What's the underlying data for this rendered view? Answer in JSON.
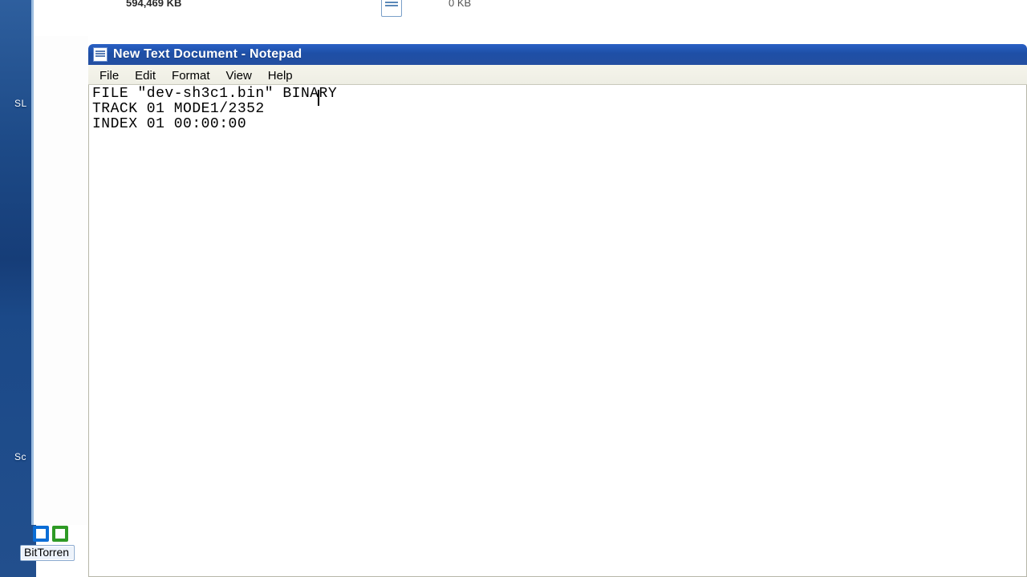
{
  "desktop": {
    "icon_labels": {
      "a": "SL",
      "b": "Sc",
      "bt": "BitTorren"
    }
  },
  "explorer": {
    "size_left": "594,469 KB",
    "size_right": "0 KB"
  },
  "notepad": {
    "title": "New Text Document - Notepad",
    "menu": {
      "file": "File",
      "edit": "Edit",
      "format": "Format",
      "view": "View",
      "help": "Help"
    },
    "content": {
      "line1": "FILE \"dev-sh3c1.bin\" BINARY",
      "line2": "TRACK 01 MODE1/2352",
      "line3": "INDEX 01 00:00:00"
    }
  }
}
